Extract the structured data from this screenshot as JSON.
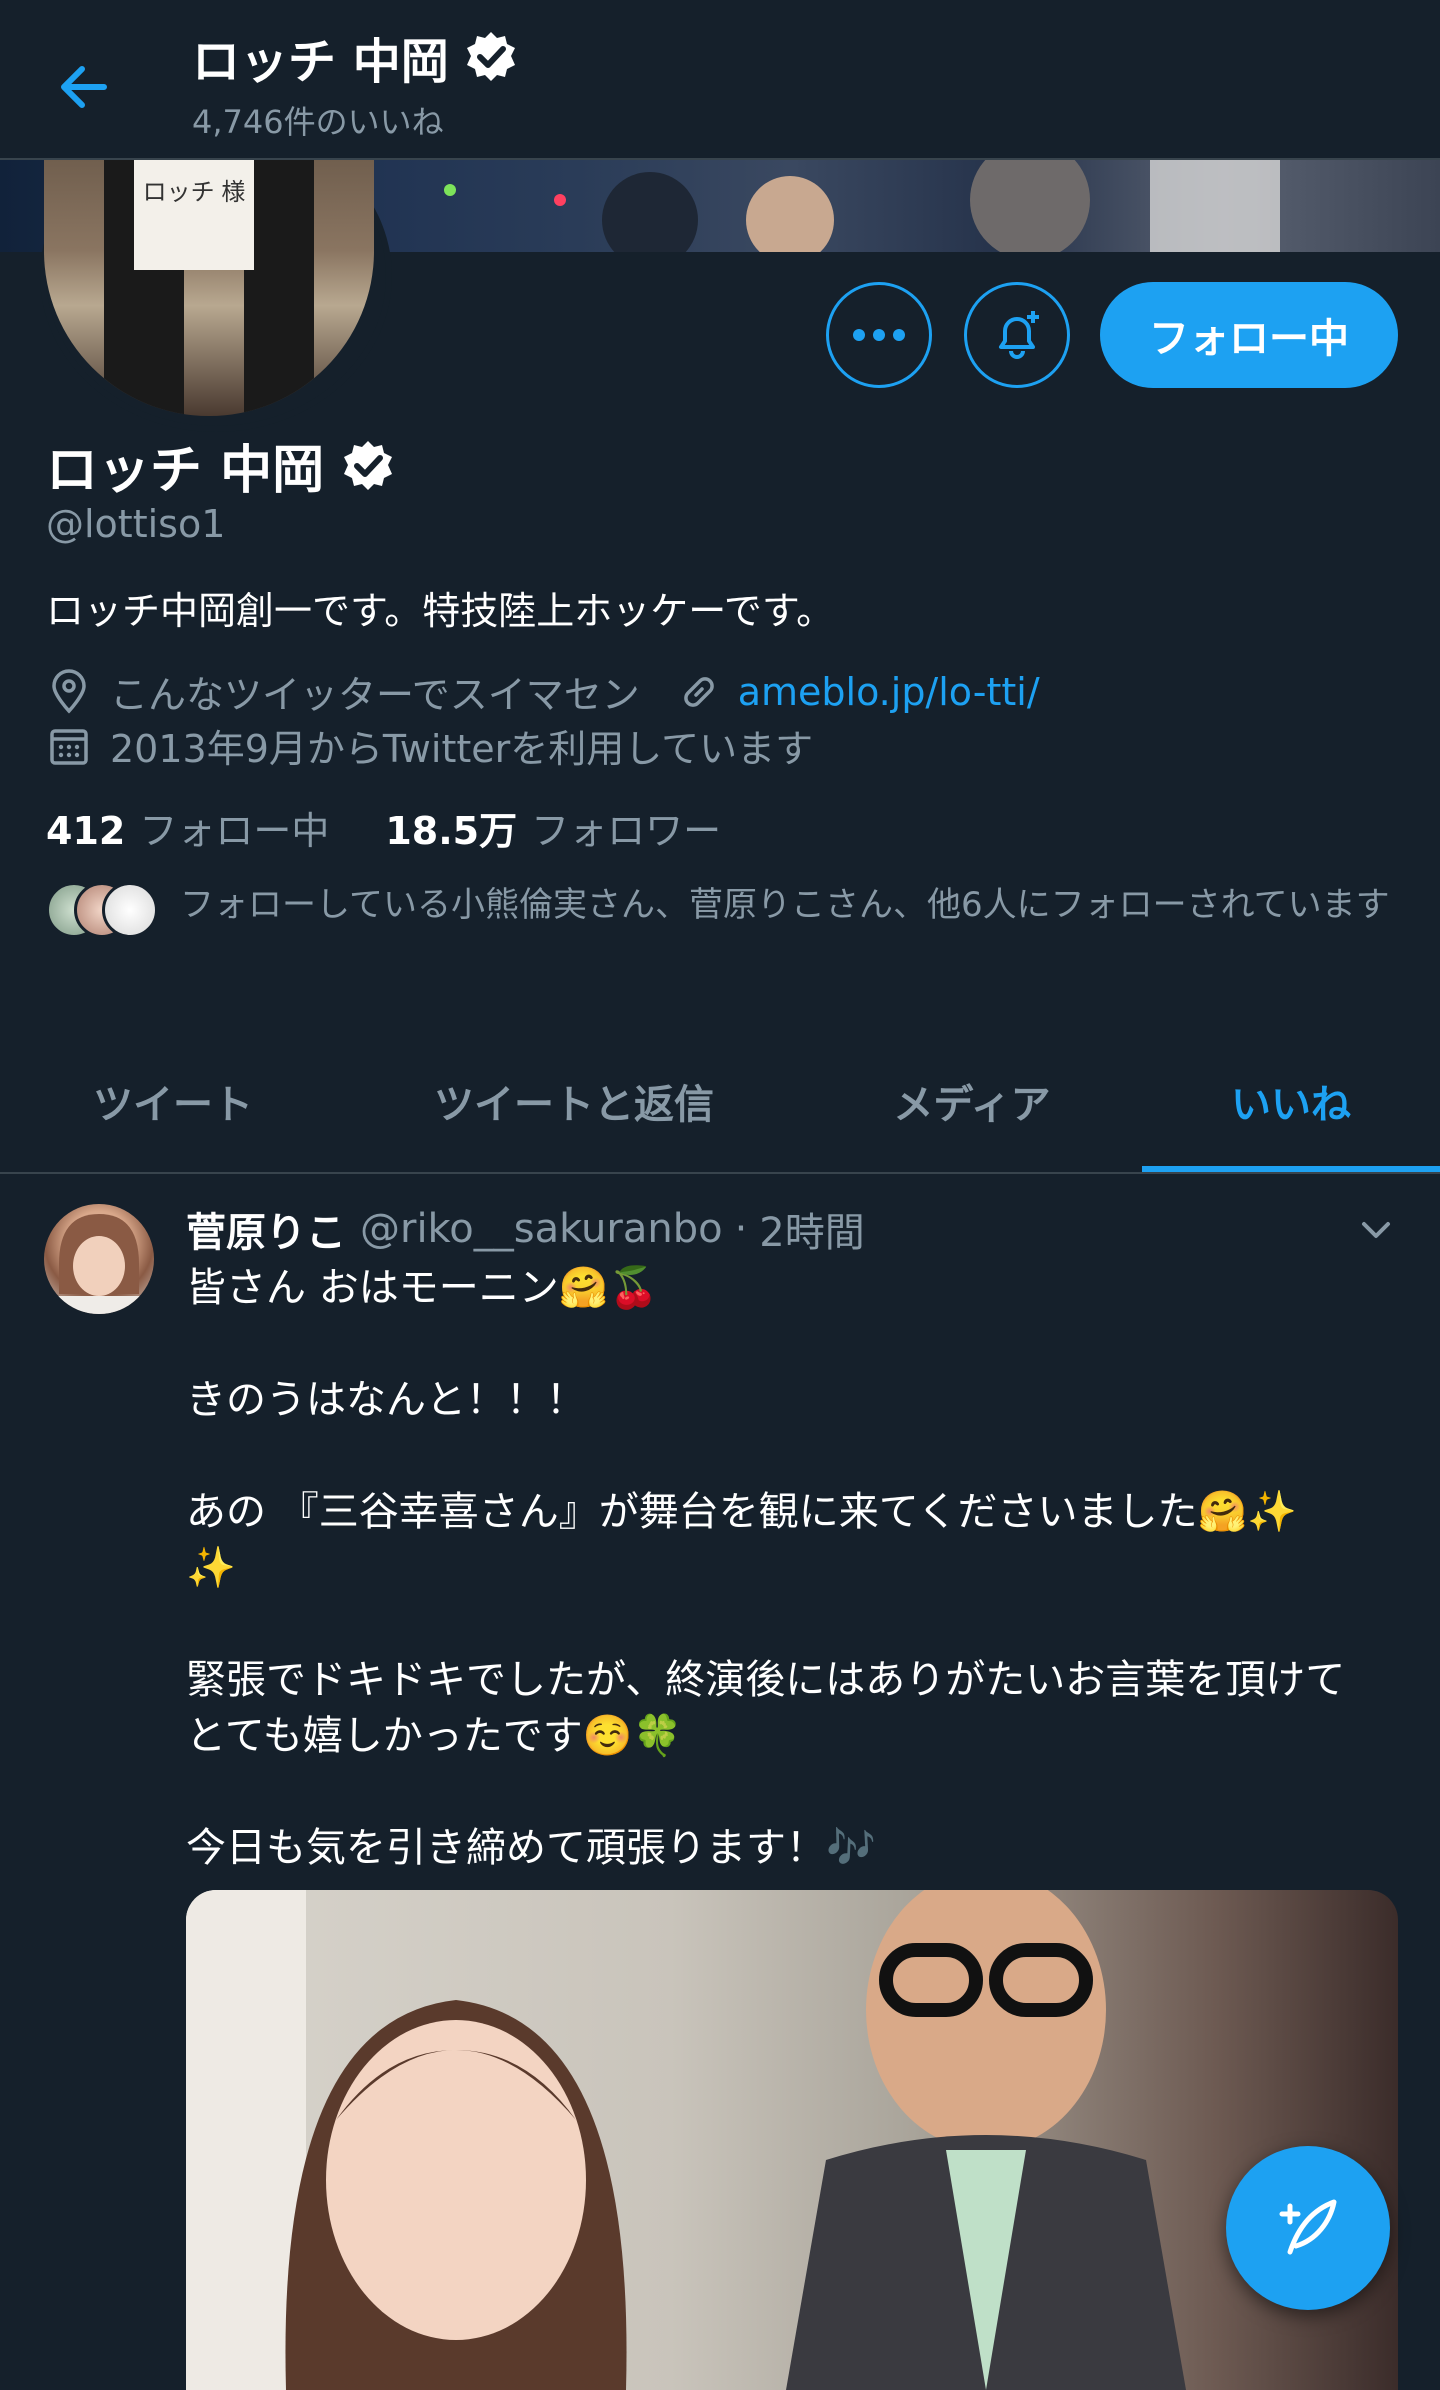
{
  "header": {
    "title": "ロッチ 中岡",
    "subtitle": "4,746件のいいね"
  },
  "profile": {
    "name": "ロッチ 中岡",
    "handle": "@lottiso1",
    "bio": "ロッチ中岡創一です。特技陸上ホッケーです。",
    "location": "こんなツイッターでスイマセン",
    "website": "ameblo.jp/lo-tti/",
    "joined": "2013年9月からTwitterを利用しています",
    "following_count": "412",
    "following_label": "フォロー中",
    "followers_count": "18.5万",
    "followers_label": "フォロワー",
    "followed_by": "フォローしている小熊倫実さん、菅原りこさん、他6人にフォローされています",
    "avatar_sign": "ロッチ 様"
  },
  "actions": {
    "follow_button": "フォロー中"
  },
  "tabs": [
    {
      "label": "ツイート"
    },
    {
      "label": "ツイートと返信"
    },
    {
      "label": "メディア"
    },
    {
      "label": "いいね",
      "active": true
    }
  ],
  "tweet": {
    "name": "菅原りこ",
    "handle": "@riko__sakuranbo",
    "separator": "·",
    "time": "2時間",
    "body": "皆さん おはモーニン🤗🍒\n\nきのうはなんと！！！\n\nあの 『三谷幸喜さん』が舞台を観に来てくださいました🤗✨\n✨\n\n緊張でドキドキでしたが、終演後にはありがたいお言葉を頂けて\nとても嬉しかったです☺️🍀\n\n今日も気を引き締めて頑張ります！🎶"
  },
  "colors": {
    "background": "#15202b",
    "accent": "#1da1f2",
    "secondary_text": "#8899a6",
    "divider": "#38444d"
  },
  "icons": [
    "back-arrow-icon",
    "verified-badge-icon",
    "more-icon",
    "bell-plus-icon",
    "location-pin-icon",
    "link-icon",
    "calendar-icon",
    "chevron-down-icon",
    "compose-tweet-icon"
  ]
}
